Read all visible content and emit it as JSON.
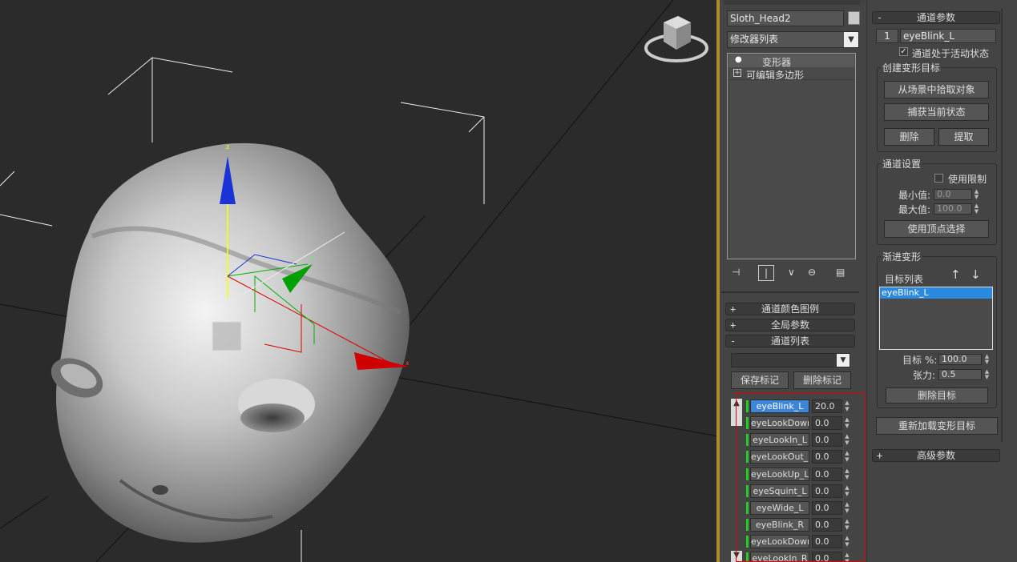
{
  "object": {
    "name": "Sloth_Head2"
  },
  "modifier_list": {
    "placeholder": "修改器列表"
  },
  "stack": {
    "items": [
      {
        "label": "变形器"
      },
      {
        "label": "可编辑多边形"
      }
    ]
  },
  "rollouts": {
    "channel_color_legend": "通道颜色图例",
    "global_params": "全局参数",
    "channel_list": "通道列表",
    "channel_params": "通道参数",
    "advanced_params": "高级参数"
  },
  "channel_list_panel": {
    "save_marker": "保存标记",
    "delete_marker": "删除标记",
    "channels": [
      {
        "name": "eyeBlink_L",
        "value": "20.0",
        "selected": true
      },
      {
        "name": "eyeLookDown_L",
        "value": "0.0"
      },
      {
        "name": "eyeLookIn_L",
        "value": "0.0"
      },
      {
        "name": "eyeLookOut_L",
        "value": "0.0"
      },
      {
        "name": "eyeLookUp_L",
        "value": "0.0"
      },
      {
        "name": "eyeSquint_L",
        "value": "0.0"
      },
      {
        "name": "eyeWide_L",
        "value": "0.0"
      },
      {
        "name": "eyeBlink_R",
        "value": "0.0"
      },
      {
        "name": "eyeLookDown_R",
        "value": "0.0"
      },
      {
        "name": "eyeLookIn_R",
        "value": "0.0"
      }
    ]
  },
  "channel_params_panel": {
    "channel_number": "1",
    "channel_name": "eyeBlink_L",
    "active_label": "通道处于活动状态",
    "create_target_title": "创建变形目标",
    "pick_from_scene": "从场景中拾取对象",
    "capture_current": "捕获当前状态",
    "delete": "删除",
    "extract": "提取",
    "channel_settings_title": "通道设置",
    "use_limits": "使用限制",
    "min_label": "最小值:",
    "min_value": "0.0",
    "max_label": "最大值:",
    "max_value": "100.0",
    "use_vertex_selection": "使用顶点选择",
    "progressive_title": "渐进变形",
    "target_list_label": "目标列表",
    "targets": [
      "eyeBlink_L"
    ],
    "target_pct_label": "目标 %:",
    "target_pct_value": "100.0",
    "tension_label": "张力:",
    "tension_value": "0.5",
    "delete_target": "删除目标",
    "reload_targets": "重新加载变形目标"
  },
  "viewport": {
    "gizmo_axes": {
      "x": "x",
      "y": "y",
      "z": "z"
    }
  },
  "colors": {
    "accent": "#b08c28",
    "selected": "#3d85d8",
    "channel_active": "#1fd01f",
    "highlight_box": "#e00000"
  }
}
